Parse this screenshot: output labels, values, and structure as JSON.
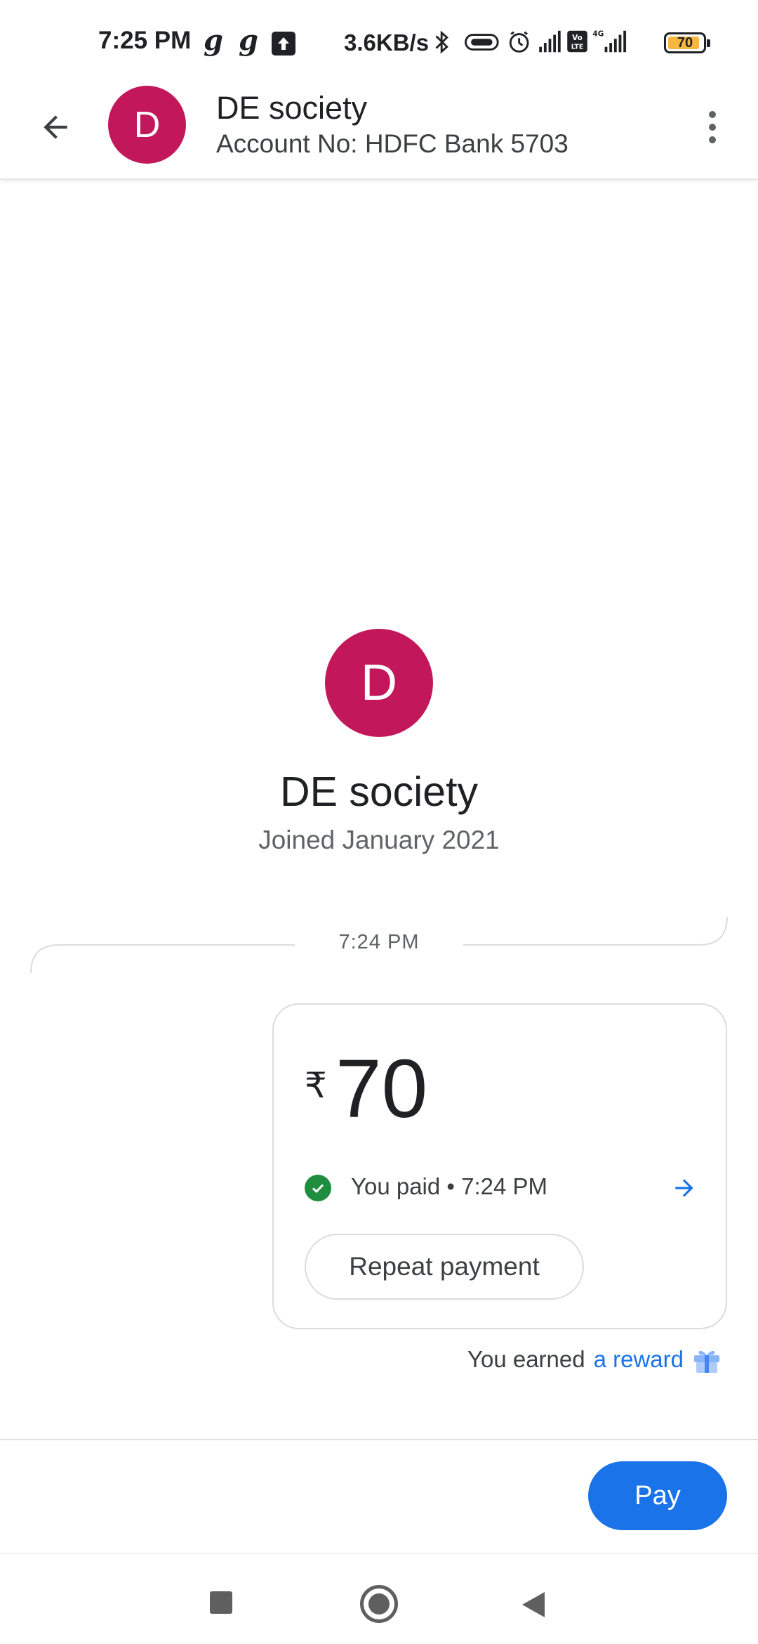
{
  "status_bar": {
    "time": "7:25 PM",
    "app_icon_1": "g",
    "app_icon_2": "g",
    "speed": "3.6KB/s",
    "network": "4G",
    "battery": "70"
  },
  "header": {
    "avatar_letter": "D",
    "title": "DE society",
    "subtitle": "Account No: HDFC Bank 5703"
  },
  "profile": {
    "avatar_letter": "D",
    "name": "DE society",
    "joined": "Joined January 2021"
  },
  "timeline": {
    "timestamp": "7:24 PM"
  },
  "payment": {
    "currency_symbol": "₹",
    "amount": "70",
    "status": "You paid • 7:24 PM",
    "repeat_label": "Repeat payment"
  },
  "reward": {
    "prefix": "You earned",
    "link": "a reward"
  },
  "footer": {
    "pay_label": "Pay"
  },
  "colors": {
    "avatar": "#c2185b",
    "accent": "#1a73e8",
    "success": "#1e8e3e"
  },
  "icons": [
    "back-arrow-icon",
    "more-vert-icon",
    "check-circle-icon",
    "arrow-forward-icon",
    "gift-icon",
    "bluetooth-icon",
    "alarm-icon",
    "signal-icon",
    "volte-icon",
    "battery-icon",
    "upload-icon"
  ]
}
